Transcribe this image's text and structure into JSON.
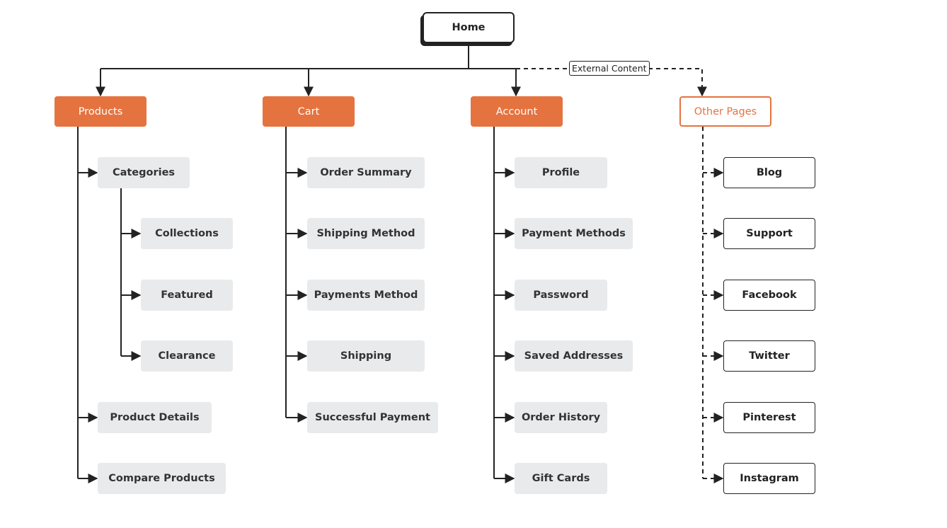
{
  "colors": {
    "accent": "#e5733f",
    "line": "#222222",
    "child_bg": "#e8eaeb"
  },
  "home": "Home",
  "external_label": "External Content",
  "sections": [
    {
      "label": "Products",
      "style": "filled",
      "children": [
        "Categories",
        "Collections",
        "Featured",
        "Clearance",
        "Product Details",
        "Compare Products"
      ]
    },
    {
      "label": "Cart",
      "style": "filled",
      "children": [
        "Order Summary",
        "Shipping Method",
        "Payments Method",
        "Shipping",
        "Successful Payment"
      ]
    },
    {
      "label": "Account",
      "style": "filled",
      "children": [
        "Profile",
        "Payment Methods",
        "Password",
        "Saved Addresses",
        "Order History",
        "Gift Cards"
      ]
    },
    {
      "label": "Other Pages",
      "style": "outline",
      "children": [
        "Blog",
        "Support",
        "Facebook",
        "Twitter",
        "Pinterest",
        "Instagram"
      ]
    }
  ]
}
